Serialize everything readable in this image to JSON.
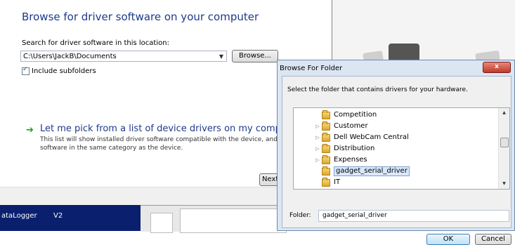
{
  "wizard": {
    "heading": "Browse for driver software on your computer",
    "search_label": "Search for driver software in this location:",
    "path_value": "C:\\Users\\JackB\\Documents",
    "browse_label": "Browse...",
    "include_subfolders_label": "Include subfolders",
    "include_subfolders_checked": true,
    "pick_title": "Let me pick from a list of device drivers on my computer",
    "pick_desc": "This list will show installed driver software compatible with the device, and all drive software in the same category as the device.",
    "next_label": "Next"
  },
  "taskbar": {
    "app_label": "ataLogger",
    "version_label": "V2"
  },
  "dialog": {
    "title": "Browse For Folder",
    "close_label": "x",
    "instruction": "Select the folder that contains drivers for your hardware.",
    "tree_items": [
      {
        "label": "Competition",
        "expandable": false,
        "selected": false
      },
      {
        "label": "Customer",
        "expandable": true,
        "selected": false
      },
      {
        "label": "Dell WebCam Central",
        "expandable": true,
        "selected": false
      },
      {
        "label": "Distribution",
        "expandable": true,
        "selected": false
      },
      {
        "label": "Expenses",
        "expandable": true,
        "selected": false
      },
      {
        "label": "gadget_serial_driver",
        "expandable": false,
        "selected": true
      },
      {
        "label": "IT",
        "expandable": false,
        "selected": false
      }
    ],
    "folder_label": "Folder:",
    "folder_value": "gadget_serial_driver",
    "ok_label": "OK",
    "cancel_label": "Cancel"
  }
}
